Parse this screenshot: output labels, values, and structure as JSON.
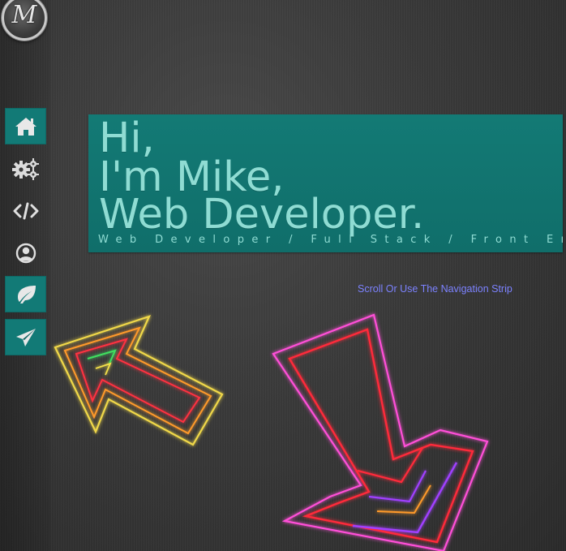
{
  "logo": {
    "letter": "M"
  },
  "nav": {
    "items": [
      {
        "id": "home",
        "icon": "home-icon",
        "active": true
      },
      {
        "id": "services",
        "icon": "gears-icon",
        "active": false
      },
      {
        "id": "code",
        "icon": "code-icon",
        "active": false
      },
      {
        "id": "about",
        "icon": "user-circle-icon",
        "active": false
      },
      {
        "id": "leaf",
        "icon": "leaf-icon",
        "active": true
      },
      {
        "id": "contact",
        "icon": "paper-plane-icon",
        "active": true
      }
    ]
  },
  "hero": {
    "line1": "Hi,",
    "line2": "I'm Mike,",
    "line3": "Web Developer.",
    "subtitle": "Web Developer / Full Stack / Front End"
  },
  "hint": {
    "text": "Scroll Or Use The Navigation Strip"
  },
  "colors": {
    "accent_teal": "#127a76",
    "hero_text": "#8fdcd3",
    "hint_text": "#7c82ff",
    "icon_light": "#e8e8e8",
    "neon_red": "#ff2a3a",
    "neon_magenta": "#ff4fd8",
    "neon_yellow": "#f4e04a",
    "neon_orange": "#ff9a2a",
    "neon_purple": "#a040ff",
    "neon_green": "#40e060"
  }
}
